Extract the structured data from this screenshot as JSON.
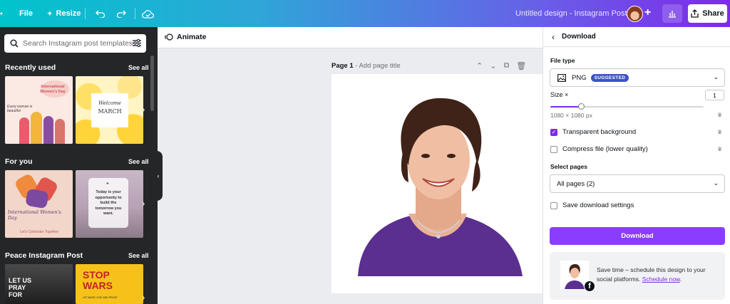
{
  "topbar": {
    "file_label": "File",
    "resize_label": "Resize",
    "design_title": "Untitled design - Instagram Post",
    "share_label": "Share",
    "gradient_colors": [
      "#00c4cc",
      "#7d2ae8"
    ]
  },
  "left_panel": {
    "search_placeholder": "Search Instagram post templates",
    "sections": [
      {
        "title": "Recently used",
        "see_all": "See all",
        "templates": [
          {
            "title": "International Women's Day",
            "extra": "Every woman is beautiful"
          },
          {
            "title": "Welcome",
            "subtitle": "MARCH"
          }
        ]
      },
      {
        "title": "For you",
        "see_all": "See all",
        "templates": [
          {
            "title": "International Women's Day",
            "extra": "Let's Celebrate Together"
          },
          {
            "title": "Today is your opportunity to build the tomorrow you want."
          }
        ]
      },
      {
        "title": "Peace Instagram Post",
        "see_all": "See all",
        "templates": [
          {
            "title": "LET US PRAY FOR"
          },
          {
            "title": "STOP WARS",
            "subtitle": "LET MAKE LOVE AND PEACE"
          }
        ]
      }
    ]
  },
  "canvas": {
    "animate_label": "Animate",
    "page_label": "Page 1",
    "page_title_placeholder": "- Add page title"
  },
  "download_panel": {
    "header": "Download",
    "file_type_label": "File type",
    "file_type_value": "PNG",
    "suggested_badge": "SUGGESTED",
    "size_label": "Size ×",
    "size_value": "1",
    "size_fraction": 0.2,
    "dimensions": "1080 × 1080 px",
    "transparent_label": "Transparent background",
    "transparent_checked": true,
    "compress_label": "Compress file (lower quality)",
    "compress_checked": false,
    "select_pages_label": "Select pages",
    "pages_value": "All pages (2)",
    "save_settings_label": "Save download settings",
    "save_settings_checked": false,
    "download_button": "Download",
    "promo_text": "Save time – schedule this design to your social platforms.",
    "promo_link": "Schedule now",
    "promo_end": ".",
    "accent_color": "#8b3dff"
  }
}
